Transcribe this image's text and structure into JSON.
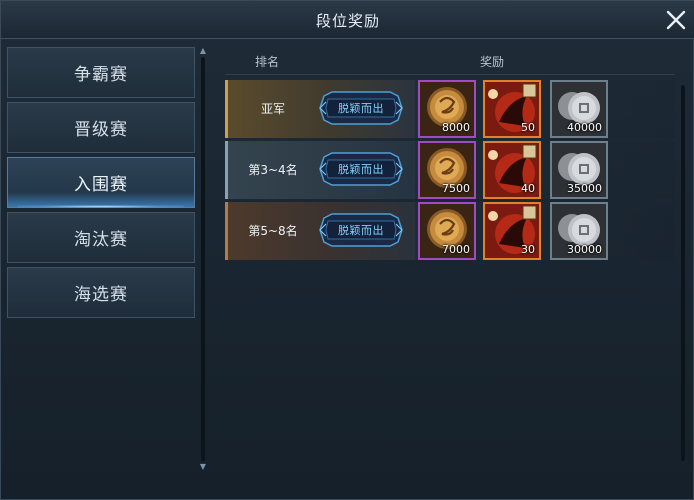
{
  "dialog": {
    "title": "段位奖励"
  },
  "tabs": [
    {
      "label": "争霸赛",
      "active": false
    },
    {
      "label": "晋级赛",
      "active": false
    },
    {
      "label": "入围赛",
      "active": true
    },
    {
      "label": "淘汰赛",
      "active": false
    },
    {
      "label": "海选赛",
      "active": false
    }
  ],
  "table": {
    "headers": {
      "rank": "排名",
      "reward": "奖励"
    },
    "rows": [
      {
        "rank": "亚军",
        "badge": "脱颖而出",
        "rewards": [
          {
            "icon": "gold-coin-icon",
            "qty": "8000"
          },
          {
            "icon": "warrior-token-icon",
            "qty": "50"
          },
          {
            "icon": "silver-coins-icon",
            "qty": "40000"
          }
        ]
      },
      {
        "rank": "第3~4名",
        "badge": "脱颖而出",
        "rewards": [
          {
            "icon": "gold-coin-icon",
            "qty": "7500"
          },
          {
            "icon": "warrior-token-icon",
            "qty": "40"
          },
          {
            "icon": "silver-coins-icon",
            "qty": "35000"
          }
        ]
      },
      {
        "rank": "第5~8名",
        "badge": "脱颖而出",
        "rewards": [
          {
            "icon": "gold-coin-icon",
            "qty": "7000"
          },
          {
            "icon": "warrior-token-icon",
            "qty": "30"
          },
          {
            "icon": "silver-coins-icon",
            "qty": "30000"
          }
        ]
      }
    ]
  },
  "colors": {
    "accent": "#3a78b0",
    "gold_border": "#c9a24e",
    "purple_quality": "#a04bc4",
    "orange_quality": "#e0822a",
    "badge_text": "#7fd2ff"
  }
}
